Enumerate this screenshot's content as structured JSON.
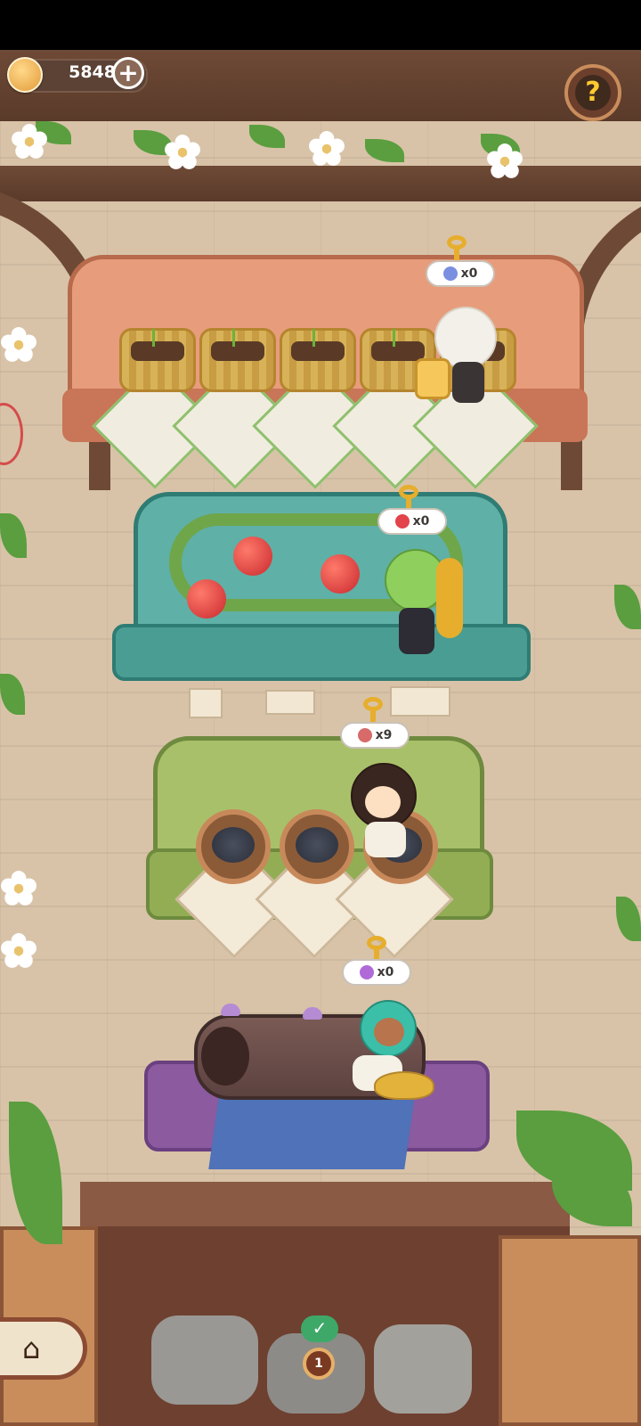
{
  "hud": {
    "coins": "5848",
    "plus_icon": "plus-icon",
    "help_icon": "question-mark-icon"
  },
  "stations": [
    {
      "name": "sprout-planter",
      "resource_icon": "flower-icon",
      "count": "x0"
    },
    {
      "name": "tomato-vine",
      "resource_icon": "tomato-icon",
      "count": "x0"
    },
    {
      "name": "coal-buckets",
      "resource_icon": "meat-icon",
      "count": "x9"
    },
    {
      "name": "mushroom-log",
      "resource_icon": "mushroom-icon",
      "count": "x0"
    }
  ],
  "bottom": {
    "home_icon": "home-icon",
    "task_count": "1",
    "check_icon": "checkmark-icon"
  },
  "colors": {
    "top_bar": "#000000",
    "wall": "#d8c3a8",
    "shelf1": "#e79d7c",
    "shelf2": "#5fb0a6",
    "shelf3": "#a9c06a",
    "shelf4": "#8b5a9f",
    "accent_gold": "#e6ae2c"
  }
}
